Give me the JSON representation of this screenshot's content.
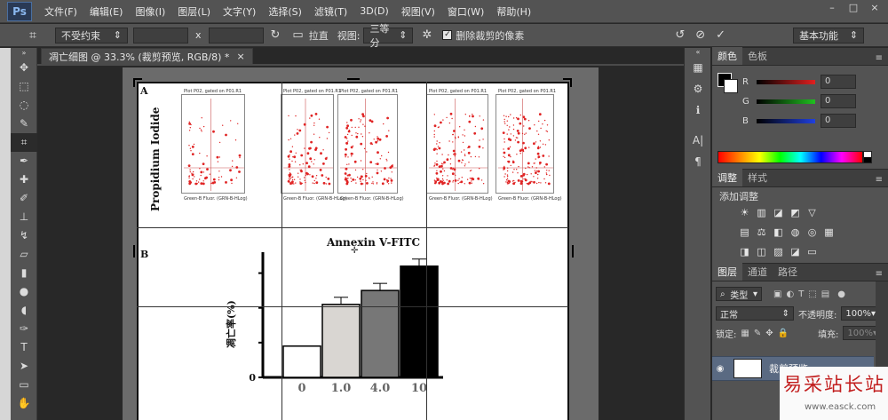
{
  "app": {
    "logo": "Ps"
  },
  "menu": [
    "文件(F)",
    "编辑(E)",
    "图像(I)",
    "图层(L)",
    "文字(Y)",
    "选择(S)",
    "滤镜(T)",
    "3D(D)",
    "视图(V)",
    "窗口(W)",
    "帮助(H)"
  ],
  "window_controls": [
    "–",
    "□",
    "×"
  ],
  "options": {
    "ratio_select": "不受约束",
    "x_sep": "x",
    "straighten_label": "拉直",
    "view_label": "视图:",
    "view_select": "三等分",
    "delete_pixels_label": "删除裁剪的像素",
    "workspace": "基本功能"
  },
  "document": {
    "tab_title": "凋亡细图 @ 33.3% (裁剪预览, RGB/8) *",
    "tab_close": "×",
    "panel_a_letter": "A",
    "panel_b_letter": "B",
    "ylabel_a": "Propidium Iodide",
    "xlabel_a": "Annexin V-FITC",
    "facs_title": "Plot P02, gated on P01.R1",
    "facs_xlabel": "Green-B Fluor. (GRN-B-HLog)",
    "ylabel_b": "凋亡率(%)",
    "bar_axis_labels": [
      "0",
      "1.0",
      "4.0",
      "10"
    ]
  },
  "panels": {
    "color_tabs": [
      "颜色",
      "色板"
    ],
    "sliders": [
      {
        "label": "R",
        "value": "0",
        "color": "#e02020"
      },
      {
        "label": "G",
        "value": "0",
        "color": "#20c020"
      },
      {
        "label": "B",
        "value": "0",
        "color": "#2040e0"
      }
    ],
    "adj_tabs": [
      "调整",
      "样式"
    ],
    "adj_title": "添加调整",
    "layer_tabs": [
      "图层",
      "通道",
      "路径"
    ],
    "filter_type": "类型",
    "blend_mode": "正常",
    "opacity_label": "不透明度:",
    "opacity_value": "100%",
    "lock_label": "锁定:",
    "fill_label": "填充:",
    "fill_value": "100%",
    "layer_name": "裁剪预览"
  },
  "watermark": {
    "title": "易采站长站",
    "url": "www.easck.com"
  },
  "chart_data": {
    "type": "bar",
    "categories": [
      "0",
      "1.0",
      "4.0",
      "10"
    ],
    "values": [
      9,
      21,
      25,
      32
    ],
    "ylim": [
      0,
      35
    ],
    "colors": [
      "#ffffff",
      "#d9d6d2",
      "#777777",
      "#000000"
    ]
  }
}
